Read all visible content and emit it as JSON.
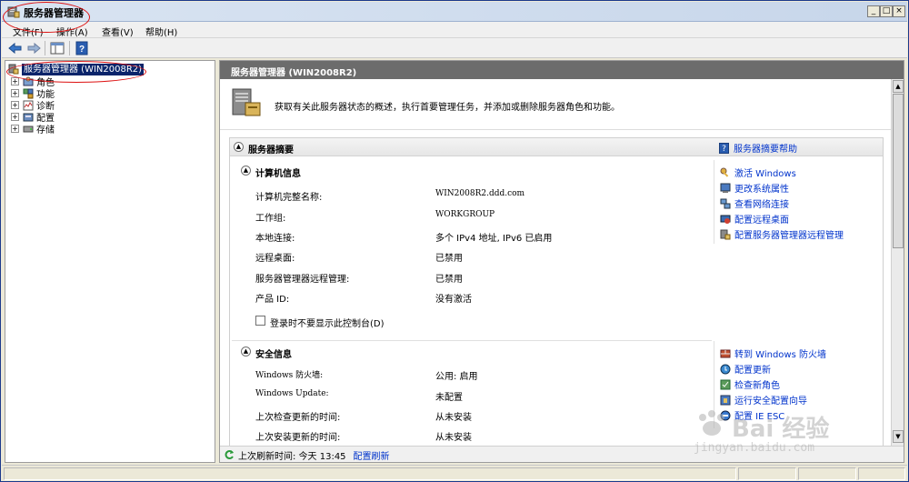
{
  "window": {
    "title": "服务器管理器",
    "controls": {
      "minimize": "_",
      "maximize": "□",
      "close": "×"
    }
  },
  "menu": [
    {
      "label": "文件(F)"
    },
    {
      "label": "操作(A)"
    },
    {
      "label": "查看(V)"
    },
    {
      "label": "帮助(H)"
    }
  ],
  "toolbar": {
    "icons": [
      "back-arrow-icon",
      "forward-arrow-icon",
      "show-hide-console-tree-icon",
      "help-icon"
    ]
  },
  "tree": {
    "root": "服务器管理器 (WIN2008R2)",
    "nodes": [
      {
        "label": "角色",
        "icon": "roles-icon"
      },
      {
        "label": "功能",
        "icon": "features-icon"
      },
      {
        "label": "诊断",
        "icon": "diagnostics-icon"
      },
      {
        "label": "配置",
        "icon": "configuration-icon"
      },
      {
        "label": "存储",
        "icon": "storage-icon"
      }
    ]
  },
  "content": {
    "header": "服务器管理器 (WIN2008R2)",
    "intro": "获取有关此服务器状态的概述，执行首要管理任务，并添加或删除服务器角色和功能。",
    "summary": {
      "title": "服务器摘要",
      "help_link": "服务器摘要帮助",
      "computer_info": {
        "title": "计算机信息",
        "rows": [
          {
            "key": "计算机完整名称:",
            "value": "WIN2008R2.ddd.com"
          },
          {
            "key": "工作组:",
            "value": "WORKGROUP"
          },
          {
            "key": "本地连接:",
            "value": "多个 IPv4 地址, IPv6 已启用"
          },
          {
            "key": "远程桌面:",
            "value": "已禁用"
          },
          {
            "key": "服务器管理器远程管理:",
            "value": "已禁用"
          },
          {
            "key": "产品 ID:",
            "value": "没有激活"
          }
        ],
        "checkbox_label": "登录时不要显示此控制台(D)",
        "tasks": [
          "激活 Windows",
          "更改系统属性",
          "查看网络连接",
          "配置远程桌面",
          "配置服务器管理器远程管理"
        ]
      },
      "security_info": {
        "title": "安全信息",
        "rows": [
          {
            "key": "Windows 防火墙:",
            "value": "公用: 启用"
          },
          {
            "key": "Windows Update:",
            "value": "未配置"
          },
          {
            "key": "上次检查更新的时间:",
            "value": "从未安装"
          },
          {
            "key": "上次安装更新的时间:",
            "value": "从未安装"
          }
        ],
        "tasks": [
          "转到 Windows 防火墙",
          "配置更新",
          "检查新角色",
          "运行安全配置向导",
          "配置 IE ESC"
        ]
      }
    },
    "refresh": {
      "text": "上次刷新时间: 今天 13:45",
      "link": "配置刷新"
    }
  },
  "watermark": {
    "text": "Bai 经验",
    "url": "jingyan.baidu.com"
  },
  "colors": {
    "selection": "#0a246a",
    "link": "#0033cc",
    "header_bar": "#6c6c6c",
    "annotation": "#dd1111"
  }
}
